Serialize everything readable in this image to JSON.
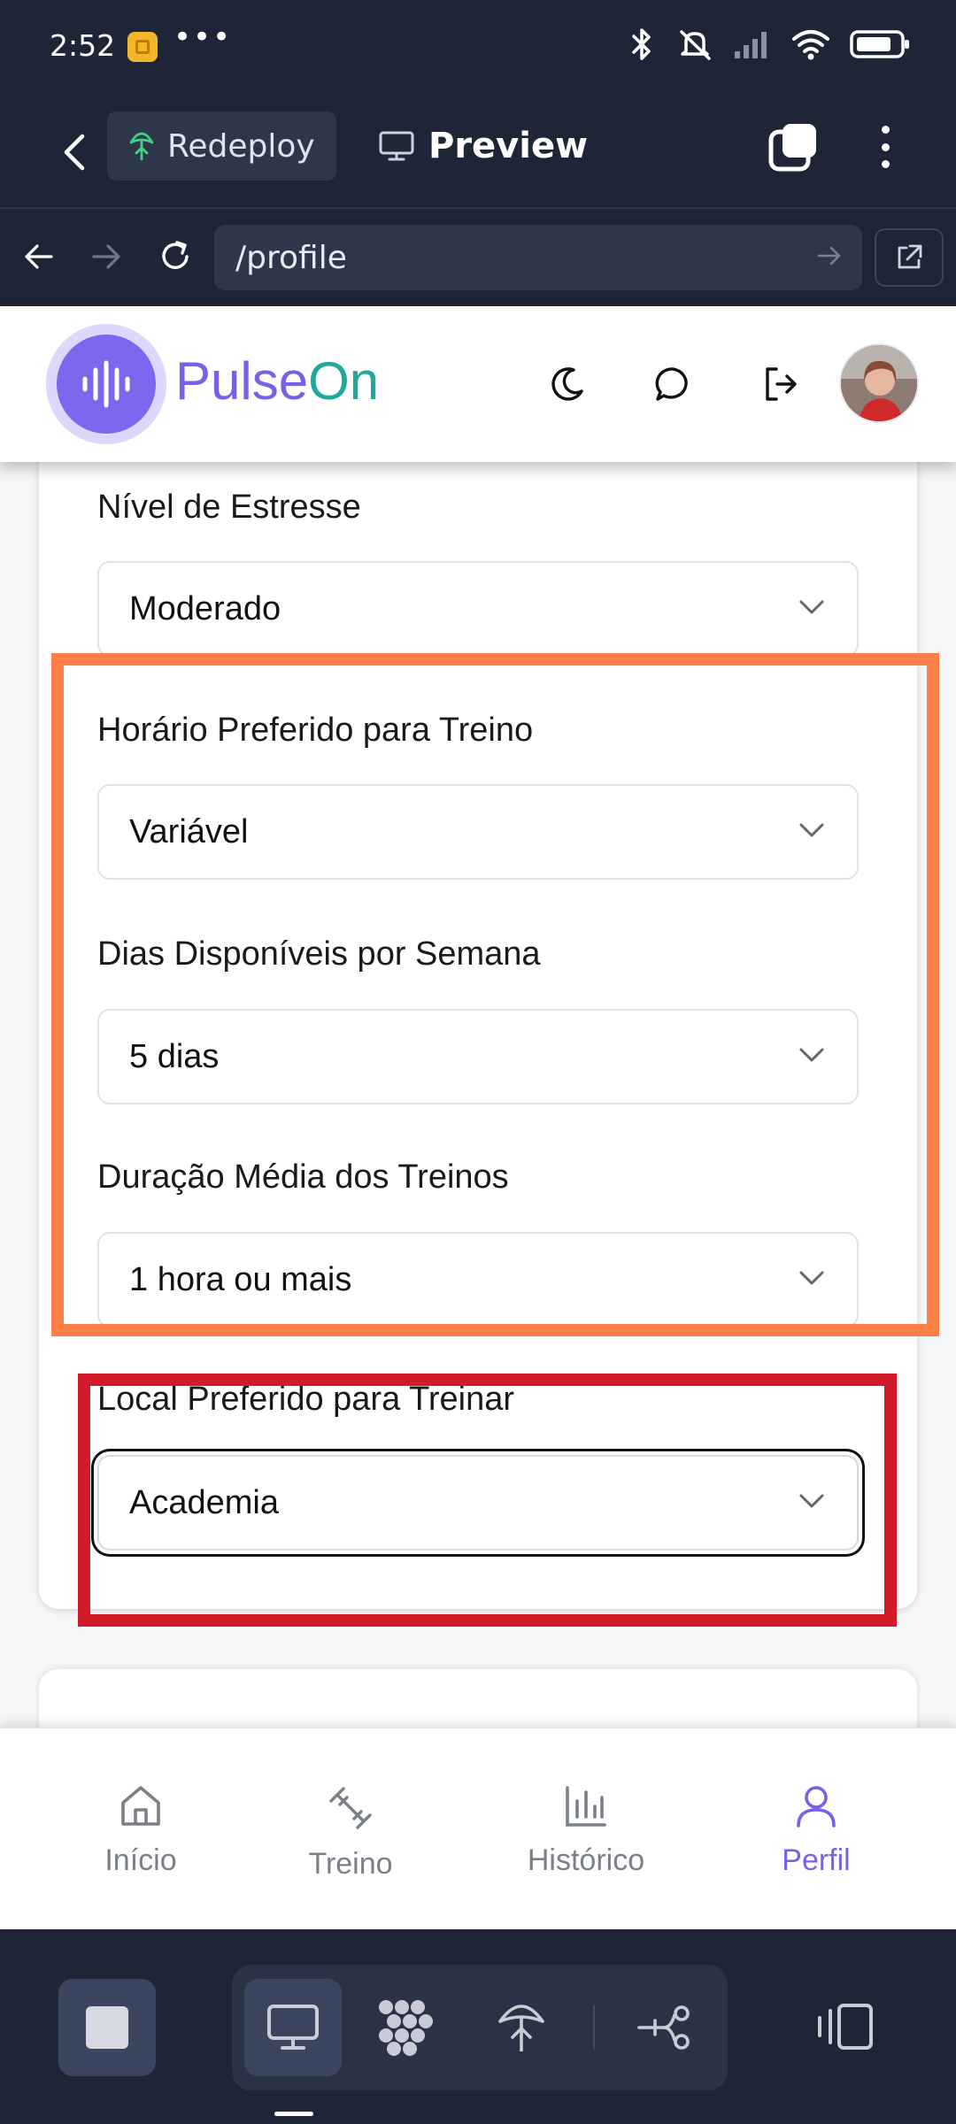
{
  "status_bar": {
    "time": "2:52",
    "more": "•••"
  },
  "appbar": {
    "redeploy_label": "Redeploy",
    "preview_label": "Preview"
  },
  "browser": {
    "url": "/profile"
  },
  "app": {
    "brand_part1": "Pulse",
    "brand_part2": "On"
  },
  "form": {
    "stress_label": "Nível de Estresse",
    "stress_value": "Moderado",
    "time_label": "Horário Preferido para Treino",
    "time_value": "Variável",
    "days_label": "Dias Disponíveis por Semana",
    "days_value": "5 dias",
    "duration_label": "Duração Média dos Treinos",
    "duration_value": "1 hora ou mais",
    "location_label": "Local Preferido para Treinar",
    "location_value": "Academia"
  },
  "bottom_nav": {
    "items": [
      {
        "label": "Início",
        "icon": "home-icon"
      },
      {
        "label": "Treino",
        "icon": "dumbbell-icon"
      },
      {
        "label": "Histórico",
        "icon": "bar-chart-icon"
      },
      {
        "label": "Perfil",
        "icon": "user-icon",
        "active": true
      }
    ]
  },
  "colors": {
    "chrome_bg": "#1e2537",
    "brand_purple": "#7a5fe9",
    "brand_teal": "#20a89b",
    "highlight_orange": "#fd7f47",
    "highlight_red": "#d11a2a"
  }
}
